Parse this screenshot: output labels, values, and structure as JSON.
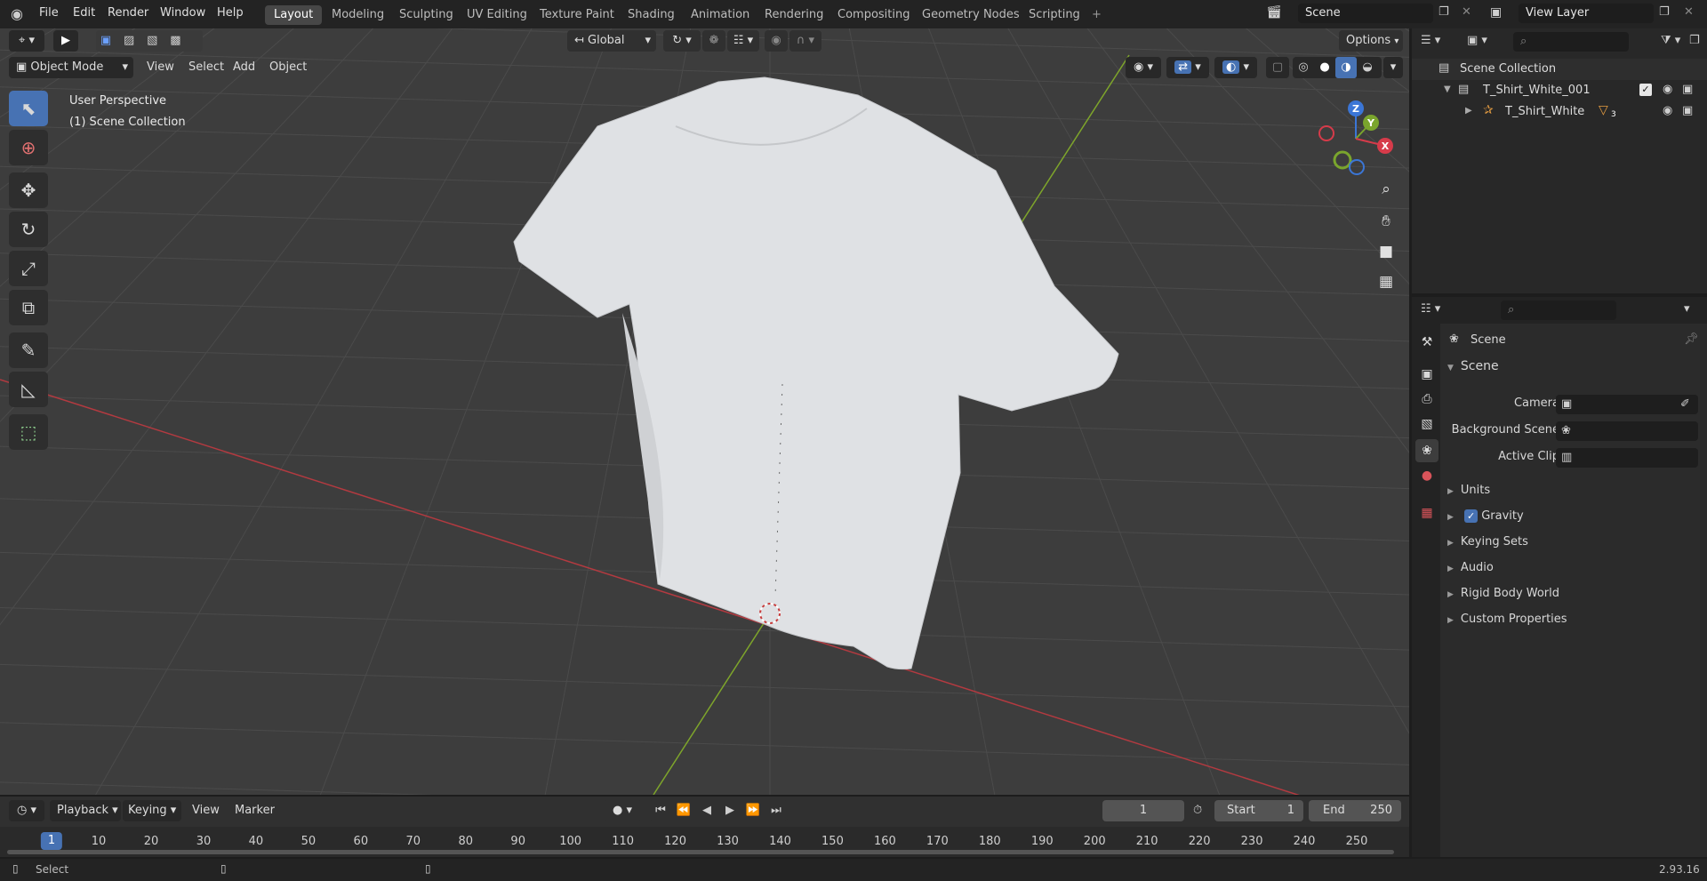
{
  "topbar": {
    "menus": [
      "File",
      "Edit",
      "Render",
      "Window",
      "Help"
    ],
    "workspaces": [
      "Layout",
      "Modeling",
      "Sculpting",
      "UV Editing",
      "Texture Paint",
      "Shading",
      "Animation",
      "Rendering",
      "Compositing",
      "Geometry Nodes",
      "Scripting"
    ],
    "active_workspace": "Layout",
    "add_tab": "+",
    "scene_name": "Scene",
    "view_layer_name": "View Layer"
  },
  "viewport": {
    "mode": "Object Mode",
    "menus": [
      "View",
      "Select",
      "Add",
      "Object"
    ],
    "orientation": "Global",
    "options_label": "Options",
    "overlay_line1": "User Perspective",
    "overlay_line2": "(1) Scene Collection",
    "gizmo_axes": {
      "x": "X",
      "y": "Y",
      "z": "Z"
    },
    "colors": {
      "bg": "#3d3d3d",
      "grid": "#4a4a4a",
      "x_axis": "#b0393f",
      "y_axis": "#7fa52a",
      "active_tool": "#4772b3"
    }
  },
  "outliner": {
    "root": "Scene Collection",
    "items": [
      {
        "name": "T_Shirt_White_001",
        "level": 1
      },
      {
        "name": "T_Shirt_White",
        "level": 2,
        "badge": "3"
      }
    ]
  },
  "properties": {
    "context_title": "Scene",
    "panel_title": "Scene",
    "fields": [
      {
        "label": "Camera"
      },
      {
        "label": "Background Scene"
      },
      {
        "label": "Active Clip"
      }
    ],
    "collapsed_panels": [
      "Units",
      "Gravity",
      "Keying Sets",
      "Audio",
      "Rigid Body World",
      "Custom Properties"
    ],
    "gravity_checked": true
  },
  "timeline": {
    "menus": [
      "Playback",
      "Keying",
      "View",
      "Marker"
    ],
    "current_frame": "1",
    "start_label": "Start",
    "start_value": "1",
    "end_label": "End",
    "end_value": "250",
    "ticks": [
      "1",
      "10",
      "20",
      "30",
      "40",
      "50",
      "60",
      "70",
      "80",
      "90",
      "100",
      "110",
      "120",
      "130",
      "140",
      "150",
      "160",
      "170",
      "180",
      "190",
      "200",
      "210",
      "220",
      "230",
      "240",
      "250"
    ]
  },
  "statusbar": {
    "left_action": "Select",
    "version": "2.93.16"
  }
}
